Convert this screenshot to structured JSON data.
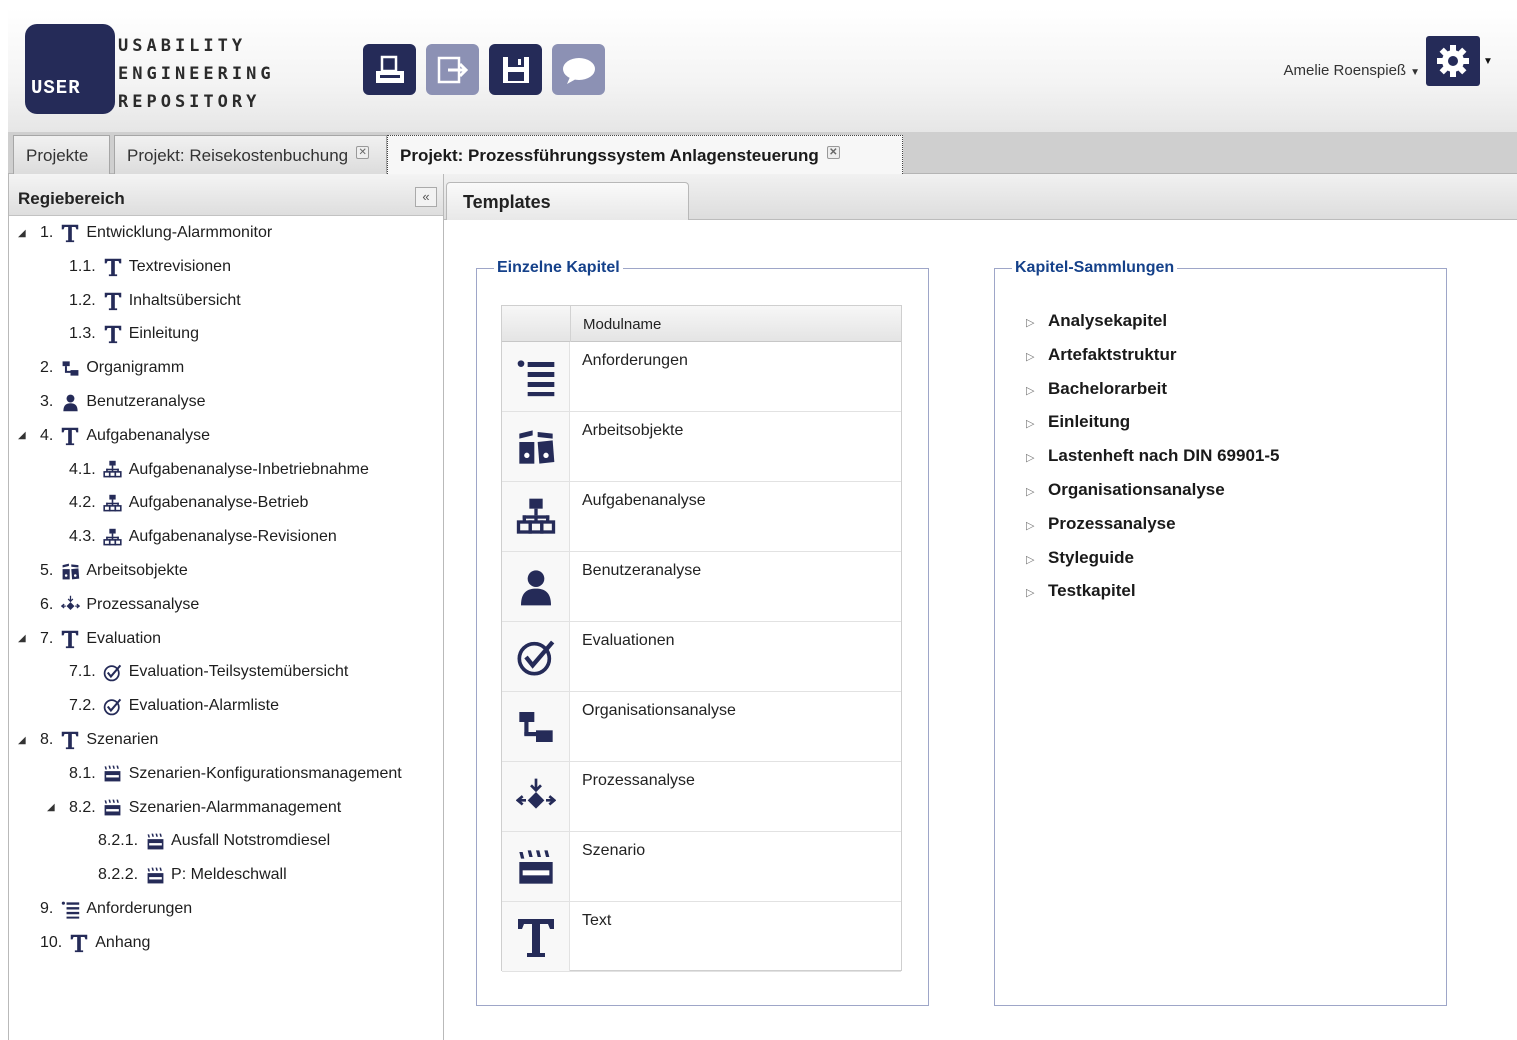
{
  "app": {
    "logo_word": "USER",
    "logo_lines": [
      "USABILITY",
      "ENGINEERING",
      "REPOSITORY"
    ]
  },
  "toolbar": {
    "buttons": [
      {
        "icon": "print-icon"
      },
      {
        "icon": "export-icon"
      },
      {
        "icon": "save-icon"
      },
      {
        "icon": "comment-icon"
      }
    ]
  },
  "user": {
    "name": "Amelie Roenspieß"
  },
  "tabs": [
    {
      "label": "Projekte",
      "closable": false,
      "active": false
    },
    {
      "label": "Projekt: Reisekostenbuchung",
      "closable": true,
      "active": false
    },
    {
      "label": "Projekt: Prozessführungssystem Anlagensteuerung",
      "closable": true,
      "active": true
    }
  ],
  "left_panel": {
    "title": "Regiebereich",
    "collapse_glyph": "«",
    "tree": [
      {
        "num": "1.",
        "label": "Entwicklung-Alarmmonitor",
        "icon": "text-icon",
        "level": 0,
        "expanded": true
      },
      {
        "num": "1.1.",
        "label": "Textrevisionen",
        "icon": "text-icon",
        "level": 1
      },
      {
        "num": "1.2.",
        "label": "Inhaltsübersicht",
        "icon": "text-icon",
        "level": 1
      },
      {
        "num": "1.3.",
        "label": "Einleitung",
        "icon": "text-icon",
        "level": 1
      },
      {
        "num": "2.",
        "label": "Organigramm",
        "icon": "org-icon",
        "level": 0
      },
      {
        "num": "3.",
        "label": "Benutzeranalyse",
        "icon": "user-icon",
        "level": 0
      },
      {
        "num": "4.",
        "label": "Aufgabenanalyse",
        "icon": "text-icon",
        "level": 0,
        "expanded": true
      },
      {
        "num": "4.1.",
        "label": "Aufgabenanalyse-Inbetriebnahme",
        "icon": "hierarchy-icon",
        "level": 1
      },
      {
        "num": "4.2.",
        "label": "Aufgabenanalyse-Betrieb",
        "icon": "hierarchy-icon",
        "level": 1
      },
      {
        "num": "4.3.",
        "label": "Aufgabenanalyse-Revisionen",
        "icon": "hierarchy-icon",
        "level": 1
      },
      {
        "num": "5.",
        "label": "Arbeitsobjekte",
        "icon": "binder-icon",
        "level": 0
      },
      {
        "num": "6.",
        "label": "Prozessanalyse",
        "icon": "process-icon",
        "level": 0
      },
      {
        "num": "7.",
        "label": "Evaluation",
        "icon": "text-icon",
        "level": 0,
        "expanded": true
      },
      {
        "num": "7.1.",
        "label": "Evaluation-Teilsystemübersicht",
        "icon": "check-icon",
        "level": 1
      },
      {
        "num": "7.2.",
        "label": "Evaluation-Alarmliste",
        "icon": "check-icon",
        "level": 1
      },
      {
        "num": "8.",
        "label": "Szenarien",
        "icon": "text-icon",
        "level": 0,
        "expanded": true
      },
      {
        "num": "8.1.",
        "label": "Szenarien-Konfigurationsmanagement",
        "icon": "clapper-icon",
        "level": 1
      },
      {
        "num": "8.2.",
        "label": "Szenarien-Alarmmanagement",
        "icon": "clapper-icon",
        "level": 1,
        "expanded": true
      },
      {
        "num": "8.2.1.",
        "label": "Ausfall Notstromdiesel",
        "icon": "clapper-icon",
        "level": 2
      },
      {
        "num": "8.2.2.",
        "label": "P: Meldeschwall",
        "icon": "clapper-icon",
        "level": 2
      },
      {
        "num": "9.",
        "label": "Anforderungen",
        "icon": "list-icon",
        "level": 0
      },
      {
        "num": "10.",
        "label": "Anhang",
        "icon": "text-icon",
        "level": 0
      }
    ]
  },
  "templates_tab": {
    "label": "Templates"
  },
  "einzelne_kapitel": {
    "legend": "Einzelne Kapitel",
    "column_header": "Modulname",
    "rows": [
      {
        "label": "Anforderungen",
        "icon": "list-icon"
      },
      {
        "label": "Arbeitsobjekte",
        "icon": "binder-icon"
      },
      {
        "label": "Aufgabenanalyse",
        "icon": "hierarchy-icon"
      },
      {
        "label": "Benutzeranalyse",
        "icon": "user-icon"
      },
      {
        "label": "Evaluationen",
        "icon": "check-icon"
      },
      {
        "label": "Organisationsanalyse",
        "icon": "org-icon"
      },
      {
        "label": "Prozessanalyse",
        "icon": "process-icon"
      },
      {
        "label": "Szenario",
        "icon": "clapper-icon"
      },
      {
        "label": "Text",
        "icon": "text-icon"
      }
    ]
  },
  "kapitel_sammlungen": {
    "legend": "Kapitel-Sammlungen",
    "items": [
      "Analysekapitel",
      "Artefaktstruktur",
      "Bachelorarbeit",
      "Einleitung",
      "Lastenheft nach DIN 69901-5",
      "Organisationsanalyse",
      "Prozessanalyse",
      "Styleguide",
      "Testkapitel"
    ]
  },
  "colors": {
    "brand": "#252b58",
    "legend": "#15418a",
    "button_light": "#8c91b4"
  }
}
